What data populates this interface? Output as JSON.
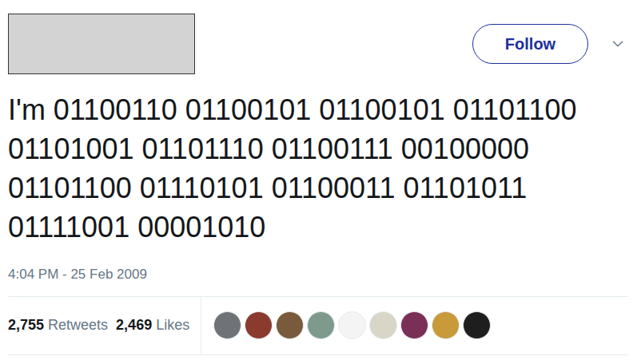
{
  "tweet": {
    "text": "I'm 01100110 01100101 01100101 01101100 01101001 01101110 01100111 00100000 01101100 01110101 01100011 01101011 01111001 00001010",
    "timestamp": "4:04 PM - 25 Feb 2009"
  },
  "follow_button": {
    "label": "Follow"
  },
  "stats": [
    {
      "count": "2,755",
      "label": "Retweets"
    },
    {
      "count": "2,469",
      "label": "Likes"
    }
  ],
  "liked_by": [
    {
      "color": "#6f7378"
    },
    {
      "color": "#8a3b2e"
    },
    {
      "color": "#7a5a3c"
    },
    {
      "color": "#7d9a8c"
    },
    {
      "color": "#f4f4f4"
    },
    {
      "color": "#d9d6c8"
    },
    {
      "color": "#7a2f57"
    },
    {
      "color": "#c89a3a"
    },
    {
      "color": "#1e1e1e"
    }
  ]
}
